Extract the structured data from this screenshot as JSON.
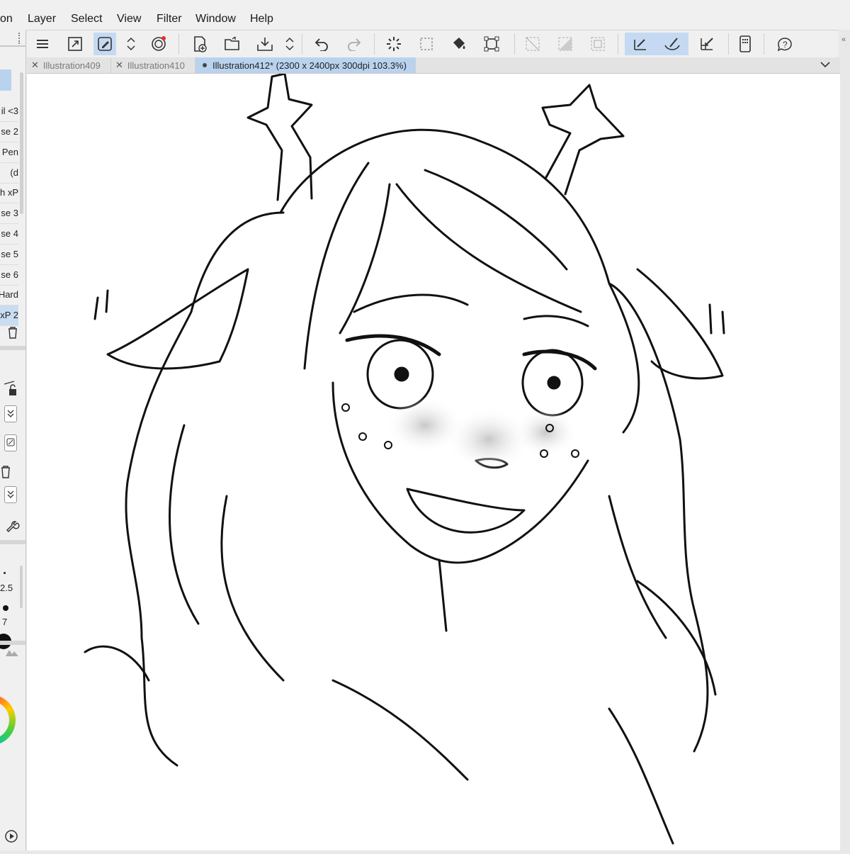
{
  "menubar": {
    "items": [
      "on",
      "Layer",
      "Select",
      "View",
      "Filter",
      "Window",
      "Help"
    ]
  },
  "toolbar": {
    "buttons": [
      "menu-icon",
      "expand-icon",
      "edit-pen-icon",
      "updown-icon",
      "spiral-icon",
      "new-file-icon",
      "open-folder-icon",
      "save-icon",
      "updown-icon",
      "undo-icon",
      "redo-icon",
      "loading-icon",
      "selection-icon",
      "fill-icon",
      "transform-icon",
      "clear-selection-icon",
      "invert-selection-icon",
      "border-selection-icon",
      "ruler-snap-icon",
      "special-ruler-snap-icon",
      "grid-snap-icon",
      "companion-icon",
      "help-icon"
    ]
  },
  "tabs": [
    {
      "label": "Illustration409",
      "active": false
    },
    {
      "label": "Illustration410",
      "active": false
    },
    {
      "label": "Illustration412* (2300 x 2400px 300dpi 103.3%)",
      "active": true
    }
  ],
  "brushes": [
    "il <3",
    "se 2",
    "Pen",
    "d)",
    "h xP",
    "se 3",
    "se 4",
    "se 5",
    "se 6",
    "Hard",
    "xP 2"
  ],
  "size_panel": {
    "size_a": "2.5",
    "size_b": "7"
  },
  "colors": {
    "selection_blue": "#c5daf2",
    "tab_active": "#b9d3ef"
  }
}
